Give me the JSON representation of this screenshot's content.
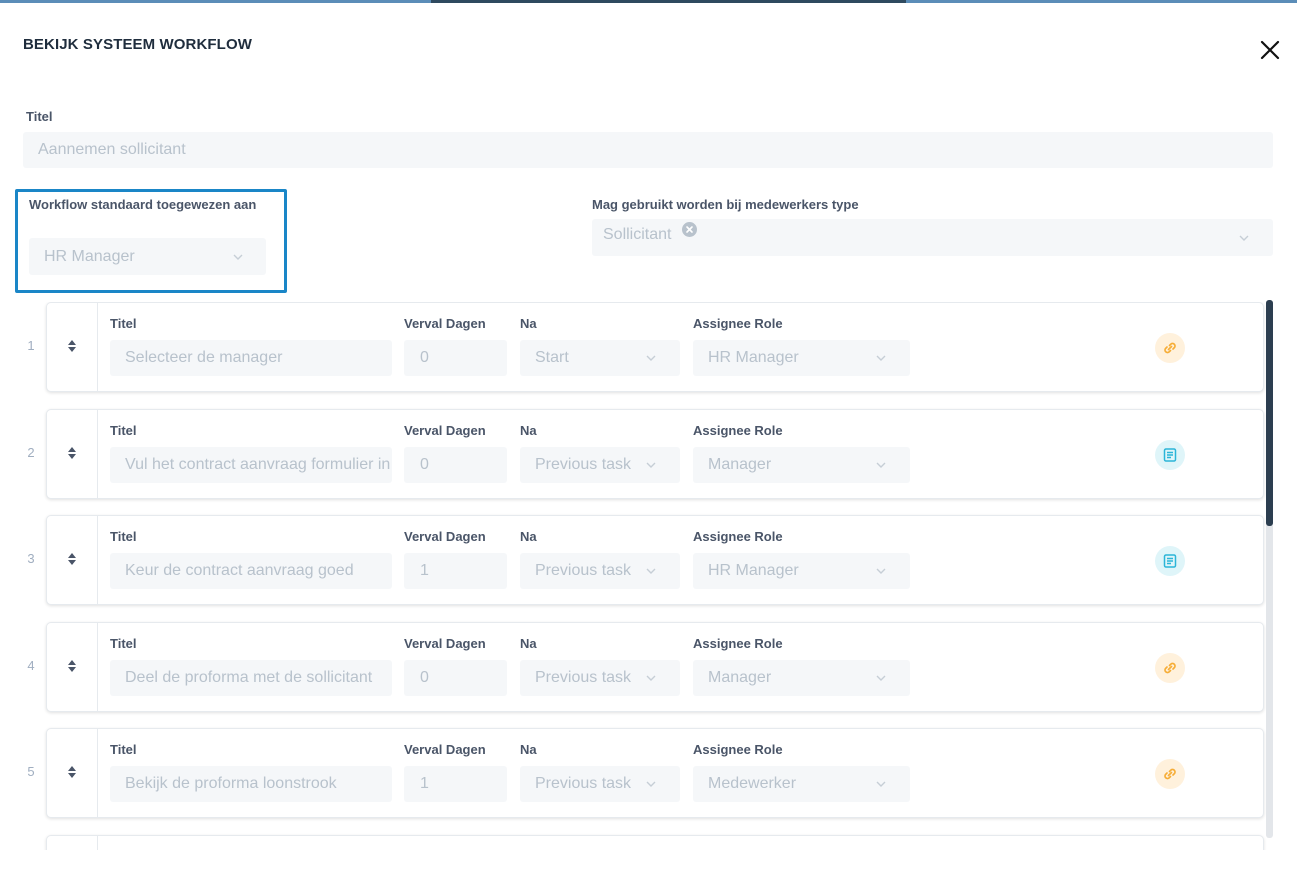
{
  "modal": {
    "title": "BEKIJK SYSTEEM WORKFLOW",
    "close_icon": "close-icon"
  },
  "form": {
    "title_label": "Titel",
    "title_value": "Aannemen sollicitant",
    "assigned_label": "Workflow standaard toegewezen aan",
    "assigned_value": "HR Manager",
    "employee_type_label": "Mag gebruikt worden bij medewerkers type",
    "employee_type_tags": [
      "Sollicitant"
    ]
  },
  "task_columns": {
    "title": "Titel",
    "due_days": "Verval Dagen",
    "after": "Na",
    "assignee": "Assignee Role"
  },
  "tasks": [
    {
      "num": "1",
      "title": "Selecteer de manager",
      "days": "0",
      "after": "Start",
      "role": "HR Manager",
      "icon": "link-icon"
    },
    {
      "num": "2",
      "title": "Vul het contract aanvraag formulier in",
      "days": "0",
      "after": "Previous task",
      "role": "Manager",
      "icon": "form-icon"
    },
    {
      "num": "3",
      "title": "Keur de contract aanvraag goed",
      "days": "1",
      "after": "Previous task",
      "role": "HR Manager",
      "icon": "form-icon"
    },
    {
      "num": "4",
      "title": "Deel de proforma met de sollicitant",
      "days": "0",
      "after": "Previous task",
      "role": "Manager",
      "icon": "link-icon"
    },
    {
      "num": "5",
      "title": "Bekijk de proforma loonstrook",
      "days": "1",
      "after": "Previous task",
      "role": "Medewerker",
      "icon": "link-icon"
    }
  ],
  "colors": {
    "accent": "#1a86c7",
    "link_icon": "#f6ad37",
    "form_icon": "#2bb5d8"
  }
}
